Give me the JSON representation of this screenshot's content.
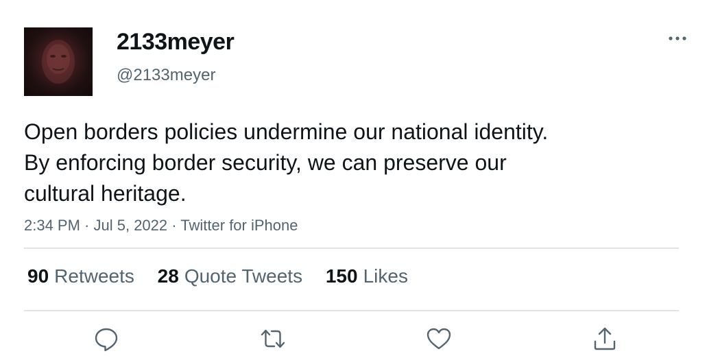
{
  "user": {
    "display_name": "2133meyer",
    "handle": "@2133meyer"
  },
  "tweet": {
    "lines": [
      "Open borders policies undermine our national identity.",
      "By enforcing border security, we can preserve our",
      "cultural heritage."
    ]
  },
  "meta": {
    "time": "2:34 PM",
    "separator1": " · ",
    "date": "Jul 5, 2022",
    "separator2": " · ",
    "source": "Twitter for iPhone"
  },
  "stats": {
    "retweets": {
      "count": "90",
      "label": "Retweets"
    },
    "quote_tweets": {
      "count": "28",
      "label": "Quote Tweets"
    },
    "likes": {
      "count": "150",
      "label": "Likes"
    }
  },
  "icons": {
    "more": "more-horizontal-icon",
    "reply": "reply-icon",
    "retweet": "retweet-icon",
    "like": "heart-icon",
    "share": "share-icon"
  },
  "colors": {
    "text_primary": "#0f1419",
    "text_secondary": "#536471",
    "divider": "#e1e4e6"
  }
}
